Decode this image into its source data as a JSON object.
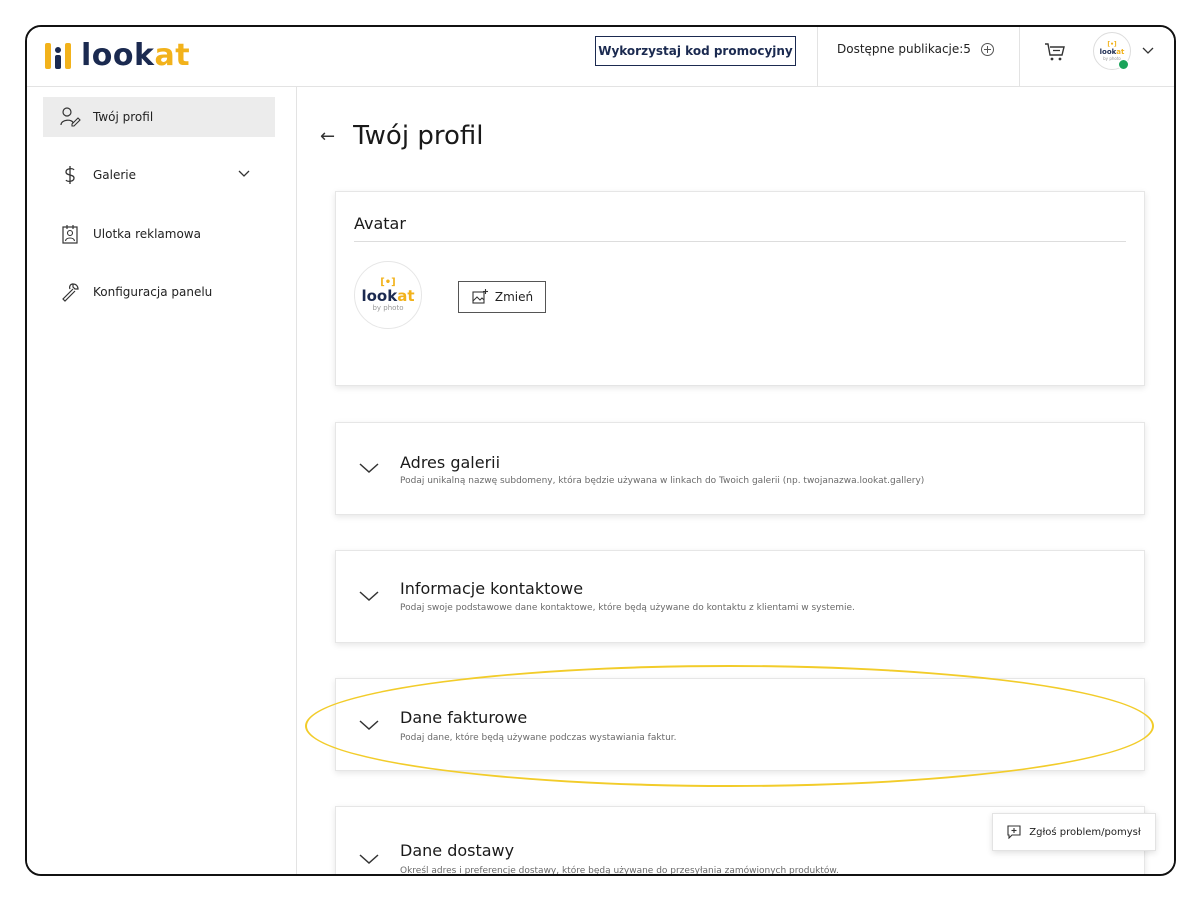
{
  "brand": {
    "logo_text_dark": "look",
    "logo_text_accent": "at"
  },
  "header": {
    "promo_label": "Wykorzystaj kod promocyjny",
    "publications_label": "Dostępne publikacje:5"
  },
  "avatar_logo": {
    "mark": "[•]",
    "text_dark": "look",
    "text_accent": "at",
    "sub": "by photo"
  },
  "sidebar": {
    "items": [
      {
        "label": "Twój profil",
        "icon": "profile-icon",
        "active": true
      },
      {
        "label": "Galerie",
        "icon": "dollar-icon",
        "active": false
      },
      {
        "label": "Ulotka reklamowa",
        "icon": "flyer-icon",
        "active": false
      },
      {
        "label": "Konfiguracja panelu",
        "icon": "wrench-icon",
        "active": false
      }
    ]
  },
  "main": {
    "title": "Twój profil",
    "avatar_card": {
      "title": "Avatar",
      "change_label": "Zmień"
    },
    "sections": [
      {
        "title": "Adres galerii",
        "desc": "Podaj unikalną nazwę subdomeny, która będzie używana w linkach do Twoich galerii (np. twojanazwa.lookat.gallery)"
      },
      {
        "title": "Informacje kontaktowe",
        "desc": "Podaj swoje podstawowe dane kontaktowe, które będą używane do kontaktu z klientami w systemie."
      },
      {
        "title": "Dane fakturowe",
        "desc": "Podaj dane, które będą używane podczas wystawiania faktur."
      },
      {
        "title": "Dane dostawy",
        "desc": "Określ adres i preferencje dostawy, które będą używane do przesyłania zamówionych produktów."
      }
    ]
  },
  "report": {
    "label": "Zgłoś problem/pomysł"
  },
  "colors": {
    "accent": "#f2b21b",
    "brand_dark": "#1b2a50",
    "online": "#1aa35a",
    "highlight": "#f2cc2a"
  }
}
